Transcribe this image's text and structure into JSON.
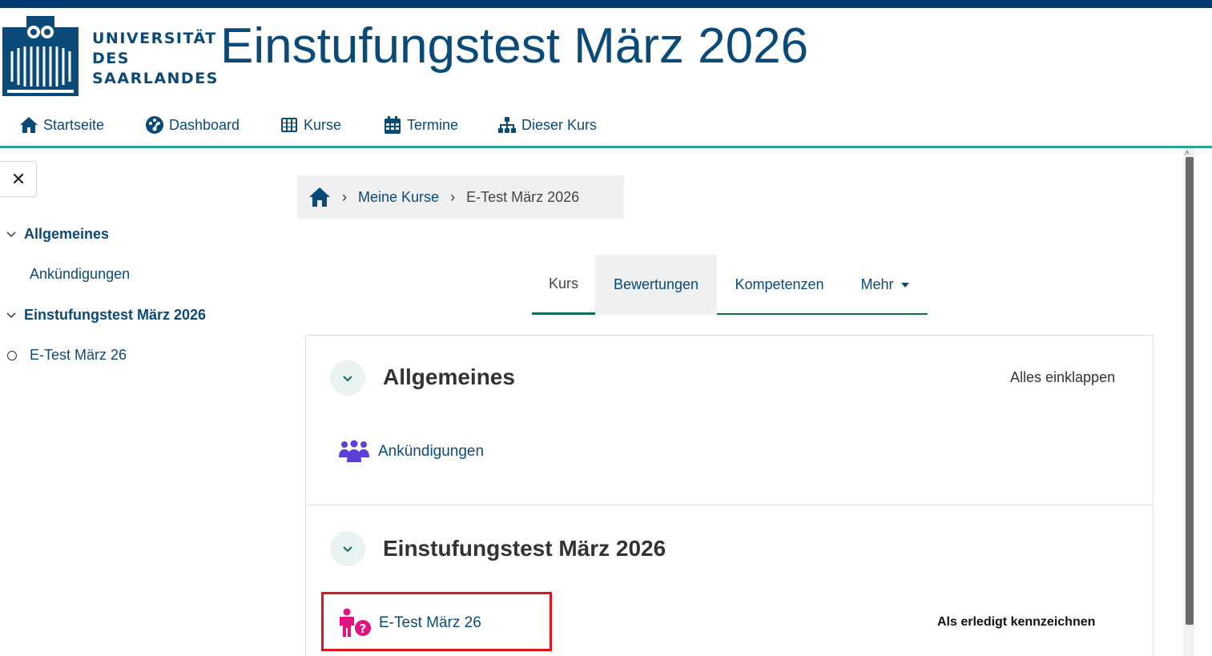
{
  "header": {
    "logo_text": [
      "UNIVERSITÄT",
      "DES",
      "SAARLANDES"
    ],
    "site_title": "Einstufungstest März 2026"
  },
  "nav": {
    "items": [
      {
        "label": "Startseite",
        "icon": "home-icon"
      },
      {
        "label": "Dashboard",
        "icon": "dashboard-icon"
      },
      {
        "label": "Kurse",
        "icon": "grid-icon"
      },
      {
        "label": "Termine",
        "icon": "calendar-icon"
      },
      {
        "label": "Dieser Kurs",
        "icon": "sitemap-icon"
      }
    ]
  },
  "course_index": {
    "close_label": "✕",
    "sections": [
      {
        "title": "Allgemeines",
        "items": [
          "Ankündigungen"
        ]
      },
      {
        "title": "Einstufungstest März 2026",
        "items": [
          "E-Test März 26"
        ]
      }
    ]
  },
  "breadcrumb": {
    "home_icon": "home-icon",
    "items": [
      "Meine Kurse",
      "E-Test März 2026"
    ]
  },
  "tabs": [
    "Kurs",
    "Bewertungen",
    "Kompetenzen",
    "Mehr"
  ],
  "content": {
    "collapse_all": "Alles einklappen",
    "sections": [
      {
        "title": "Allgemeines",
        "activities": [
          {
            "name": "Ankündigungen",
            "icon": "forum-icon"
          }
        ]
      },
      {
        "title": "Einstufungstest März 2026",
        "activities": [
          {
            "name": "E-Test März 26",
            "icon": "quiz-icon",
            "action": "Als erledigt kennzeichnen"
          }
        ]
      }
    ]
  },
  "colors": {
    "brand": "#0a4a78",
    "accent_line": "#2aa39c",
    "forum_icon": "#5b3fd6",
    "quiz_icon": "#e1137f",
    "highlight": "#e0131d"
  }
}
